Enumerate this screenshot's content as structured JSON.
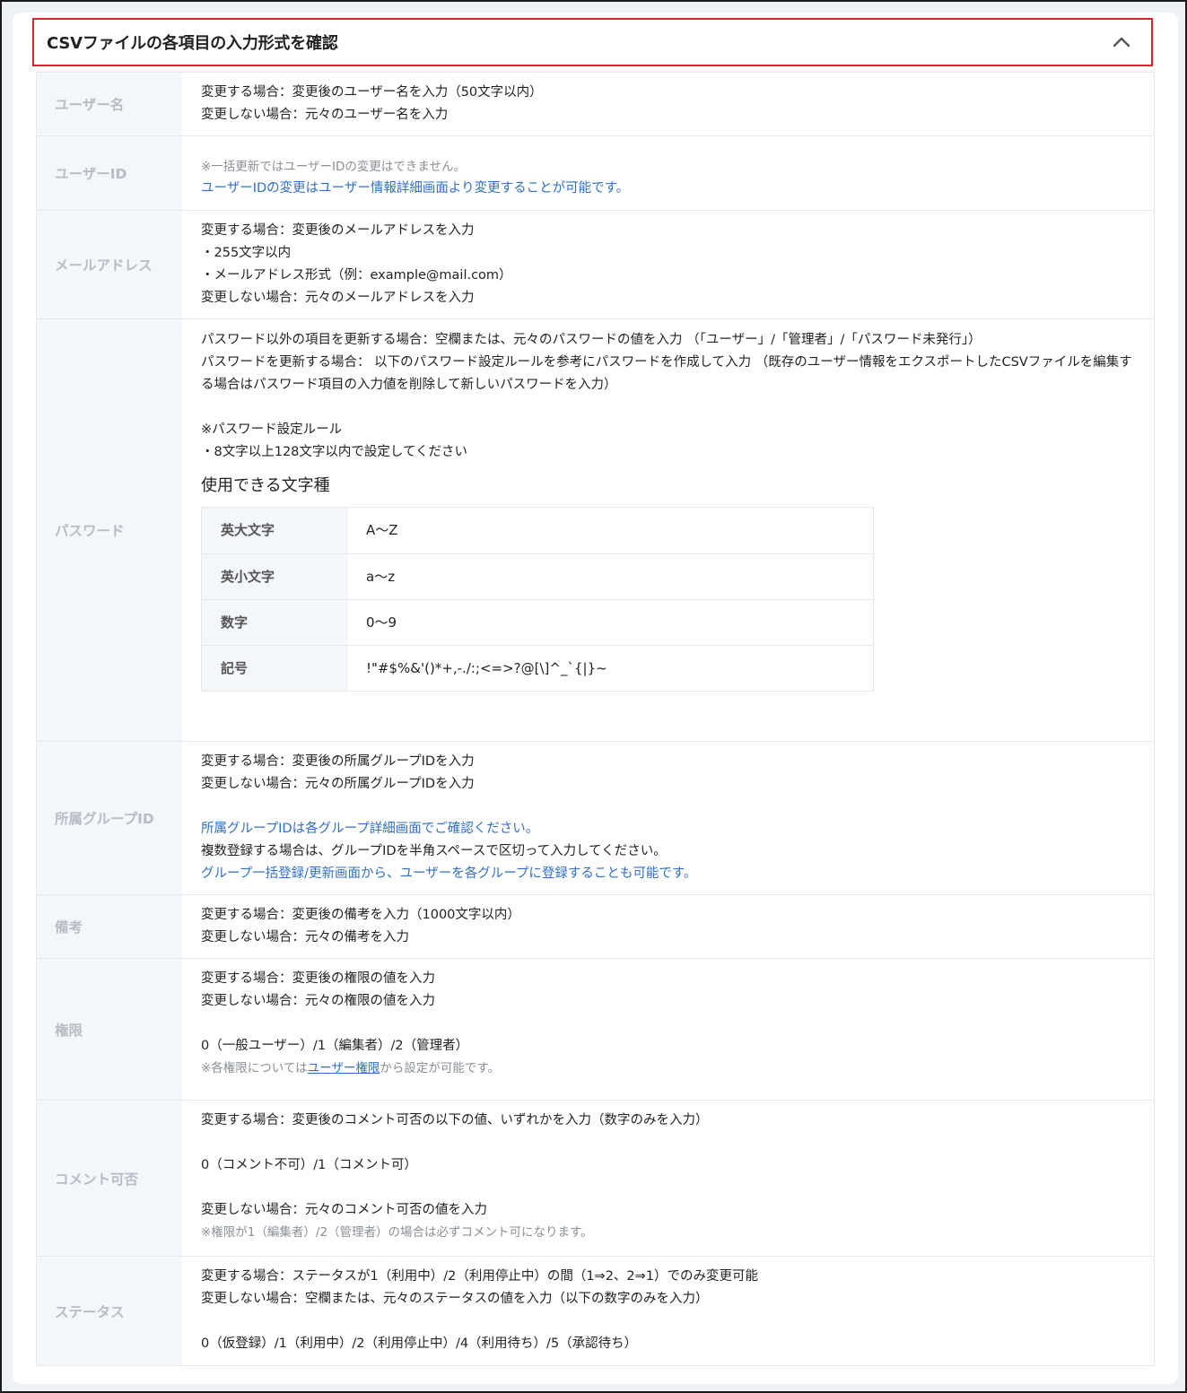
{
  "header": {
    "title": "CSVファイルの各項目の入力形式を確認"
  },
  "rows": {
    "username": {
      "label": "ユーザー名",
      "lines": [
        "変更する場合：変更後のユーザー名を入力（50文字以内）",
        "変更しない場合：元々のユーザー名を入力"
      ]
    },
    "userid": {
      "label": "ユーザーID",
      "note": "※一括更新ではユーザーIDの変更はできません。",
      "link": "ユーザーIDの変更はユーザー情報詳細画面より変更することが可能です。"
    },
    "email": {
      "label": "メールアドレス",
      "lines": [
        "変更する場合：変更後のメールアドレスを入力",
        "・255文字以内",
        "・メールアドレス形式（例：example@mail.com）",
        "変更しない場合：元々のメールアドレスを入力"
      ]
    },
    "password": {
      "label": "パスワード",
      "para1": "パスワード以外の項目を更新する場合：空欄または、元々のパスワードの値を入力 （「ユーザー」/「管理者」/「パスワード未発行」）",
      "para2": "パスワードを更新する場合： 以下のパスワード設定ルールを参考にパスワードを作成して入力 （既存のユーザー情報をエクスポートしたCSVファイルを編集する場合はパスワード項目の入力値を削除して新しいパスワードを入力）",
      "rule_title": "※パスワード設定ルール",
      "rule_1": "・8文字以上128文字以内で設定してください",
      "chars_heading": "使用できる文字種",
      "chars": [
        {
          "label": "英大文字",
          "value": "A〜Z"
        },
        {
          "label": "英小文字",
          "value": "a〜z"
        },
        {
          "label": "数字",
          "value": "0〜9"
        },
        {
          "label": "記号",
          "value": "!\"#$%&'()*+,-./:;<=>?@[\\]^_`{|}~"
        }
      ]
    },
    "group": {
      "label": "所属グループID",
      "line1": "変更する場合：変更後の所属グループIDを入力",
      "line2": "変更しない場合：元々の所属グループIDを入力",
      "link1": "所属グループIDは各グループ詳細画面でご確認ください。",
      "line3": "複数登録する場合は、グループIDを半角スペースで区切って入力してください。",
      "link2": "グループ一括登録/更新画面から、ユーザーを各グループに登録することも可能です。"
    },
    "remarks": {
      "label": "備考",
      "lines": [
        "変更する場合：変更後の備考を入力（1000文字以内）",
        "変更しない場合：元々の備考を入力"
      ]
    },
    "permission": {
      "label": "権限",
      "line1": "変更する場合：変更後の権限の値を入力",
      "line2": "変更しない場合：元々の権限の値を入力",
      "line3": "0（一般ユーザー）/1（編集者）/2（管理者）",
      "note_prefix": "※各権限については",
      "note_link": "ユーザー権限",
      "note_suffix": "から設定が可能です。"
    },
    "comment": {
      "label": "コメント可否",
      "line1": "変更する場合：変更後のコメント可否の以下の値、いずれかを入力（数字のみを入力）",
      "line2": "0（コメント不可）/1（コメント可）",
      "line3": "変更しない場合：元々のコメント可否の値を入力",
      "note": "※権限が1（編集者）/2（管理者）の場合は必ずコメント可になります。"
    },
    "status": {
      "label": "ステータス",
      "line1": "変更する場合：ステータスが1（利用中）/2（利用停止中）の間（1⇒2、2⇒1）でのみ変更可能",
      "line2": "変更しない場合：空欄または、元々のステータスの値を入力（以下の数字のみを入力）",
      "line3": "0（仮登録）/1（利用中）/2（利用停止中）/4（利用待ち）/5（承認待ち）"
    }
  }
}
